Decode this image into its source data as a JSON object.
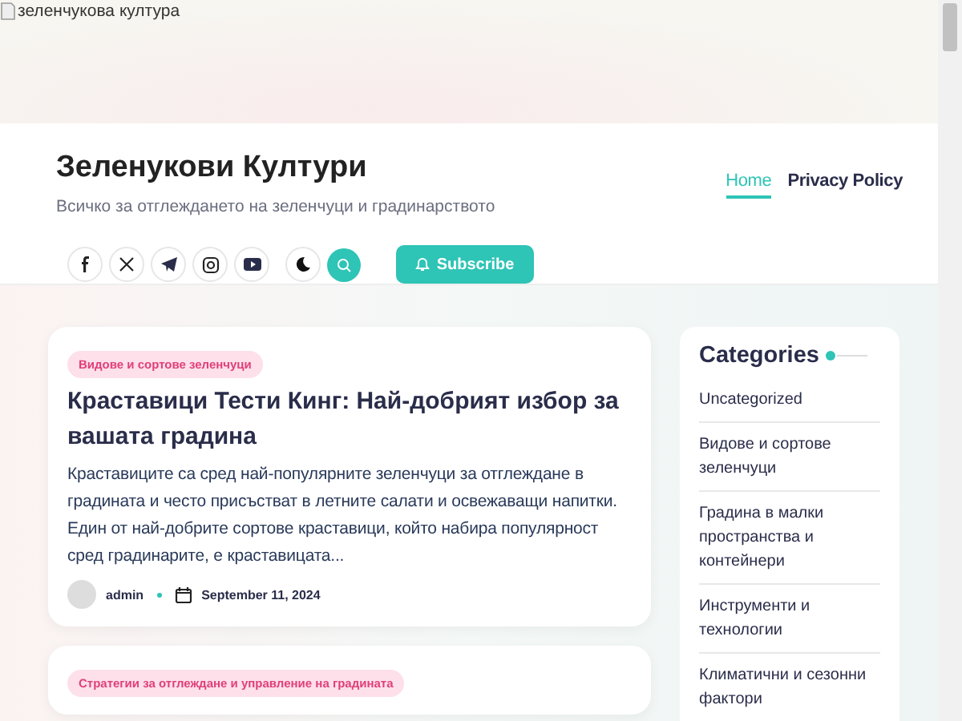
{
  "banner": {
    "image_alt": "зеленчукова култура"
  },
  "header": {
    "site_title": "Зеленукови Култури",
    "tagline": "Всичко за отглеждането на зеленчуци и градинарството",
    "subscribe_label": "Subscribe"
  },
  "nav": [
    {
      "label": "Home",
      "selected": true
    },
    {
      "label": "Privacy Policy",
      "selected": false
    }
  ],
  "posts": [
    {
      "category": "Видове и сортове зеленчуци",
      "title": "Краставици Тести Кинг: Най-добрият избор за вашата градина",
      "excerpt": "Краставиците са сред най-популярните зеленчуци за отглеждане в градината и често присъстват в летните салати и освежаващи напитки. Един от най-добрите сортове краставици, който набира популярност сред градинарите, е краставицата...",
      "author": "admin",
      "date": "September 11, 2024"
    },
    {
      "category": "Стратегии за отглеждане и управление на градината"
    }
  ],
  "sidebar": {
    "title": "Categories",
    "items": [
      "Uncategorized",
      "Видове и сортове зеленчуци",
      "Градина в малки пространства и контейнери",
      "Инструменти и технологии",
      "Климатични и сезонни фактори"
    ]
  }
}
